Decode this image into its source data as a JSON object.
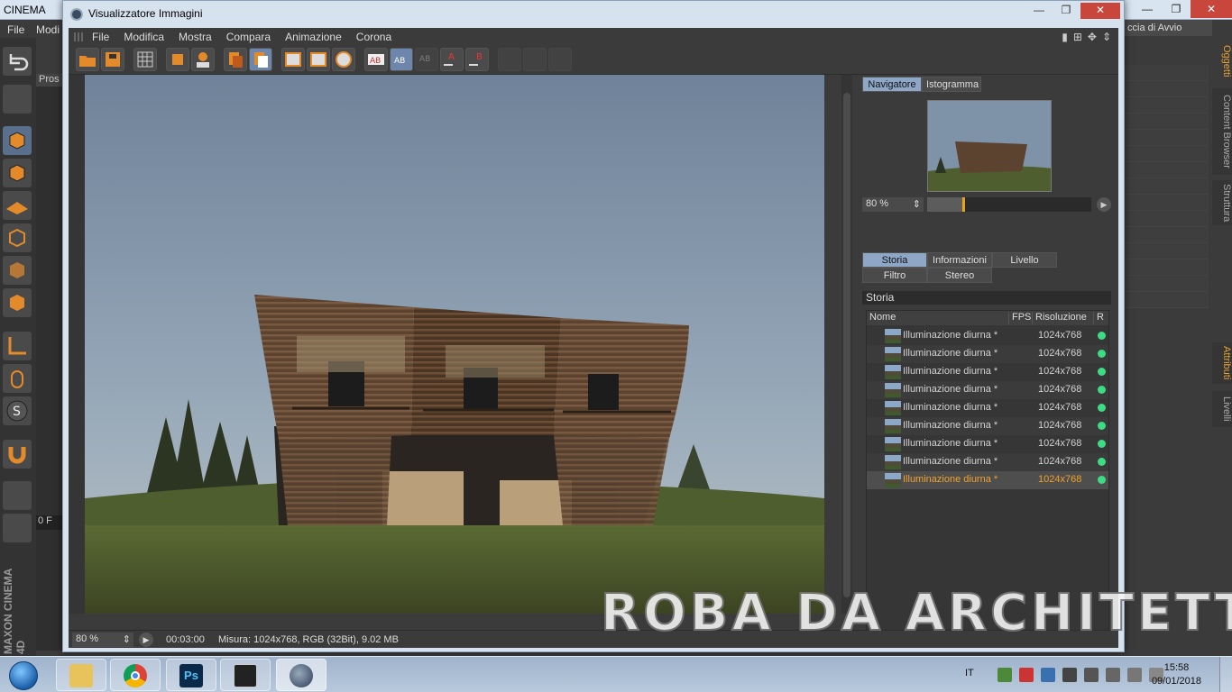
{
  "background_app": {
    "title": "CINEMA",
    "menu": [
      "File",
      "Modi"
    ],
    "layout_label": "ccia di Avvio",
    "left_panel_label": "Pros",
    "side_tabs": [
      "Oggetti",
      "Content Browser",
      "Struttura",
      "Attributi",
      "Livelli"
    ],
    "frame_field": "0 F",
    "brand": "MAXON CINEMA 4D"
  },
  "viewer": {
    "title": "Visualizzatore Immagini",
    "menu": [
      "File",
      "Modifica",
      "Mostra",
      "Compara",
      "Animazione",
      "Corona"
    ],
    "toolbar_icons": [
      "open-icon",
      "save-icon",
      "grid-icon",
      "crop-icon",
      "user-icon",
      "copy-icon",
      "paste-icon",
      "view-a-icon",
      "view-b-icon",
      "view-ab-icon",
      "ab-compare-icon",
      "ab-split-icon",
      "ab-overlay-icon",
      "set-a-icon",
      "set-b-icon",
      "channel-a-icon",
      "channel-b-icon",
      "channel-ab-icon"
    ],
    "navigator": {
      "tabs": [
        "Navigatore",
        "Istogramma"
      ],
      "active_tab": "Navigatore",
      "zoom": "80 %",
      "slider_fraction": 0.22
    },
    "info_tabs": {
      "row1": [
        "Storia",
        "Informazioni",
        "Livello"
      ],
      "row2": [
        "Filtro",
        "Stereo"
      ],
      "active": "Storia"
    },
    "history": {
      "header": "Storia",
      "columns": [
        "Nome",
        "FPS",
        "Risoluzione",
        "R"
      ],
      "rows": [
        {
          "name": "Illuminazione diurna *",
          "fps": "",
          "resolution": "1024x768"
        },
        {
          "name": "Illuminazione diurna *",
          "fps": "",
          "resolution": "1024x768"
        },
        {
          "name": "Illuminazione diurna *",
          "fps": "",
          "resolution": "1024x768"
        },
        {
          "name": "Illuminazione diurna *",
          "fps": "",
          "resolution": "1024x768"
        },
        {
          "name": "Illuminazione diurna *",
          "fps": "",
          "resolution": "1024x768"
        },
        {
          "name": "Illuminazione diurna *",
          "fps": "",
          "resolution": "1024x768"
        },
        {
          "name": "Illuminazione diurna *",
          "fps": "",
          "resolution": "1024x768"
        },
        {
          "name": "Illuminazione diurna *",
          "fps": "",
          "resolution": "1024x768"
        },
        {
          "name": "Illuminazione diurna *",
          "fps": "",
          "resolution": "1024x768"
        }
      ],
      "selected_index": 8,
      "status_color": "#3ddc84",
      "selected_color": "#f2a127"
    },
    "status": {
      "zoom": "80 %",
      "time": "00:03:00",
      "info": "Misura: 1024x768, RGB (32Bit), 9.02 MB"
    }
  },
  "watermark": "ROBA DA ARCHITETTI",
  "taskbar": {
    "apps": [
      "explorer-icon",
      "chrome-icon",
      "photoshop-icon",
      "rhino-icon",
      "cinema4d-icon"
    ],
    "ps_label": "Ps",
    "language": "IT",
    "time": "15:58",
    "date": "09/01/2018"
  }
}
